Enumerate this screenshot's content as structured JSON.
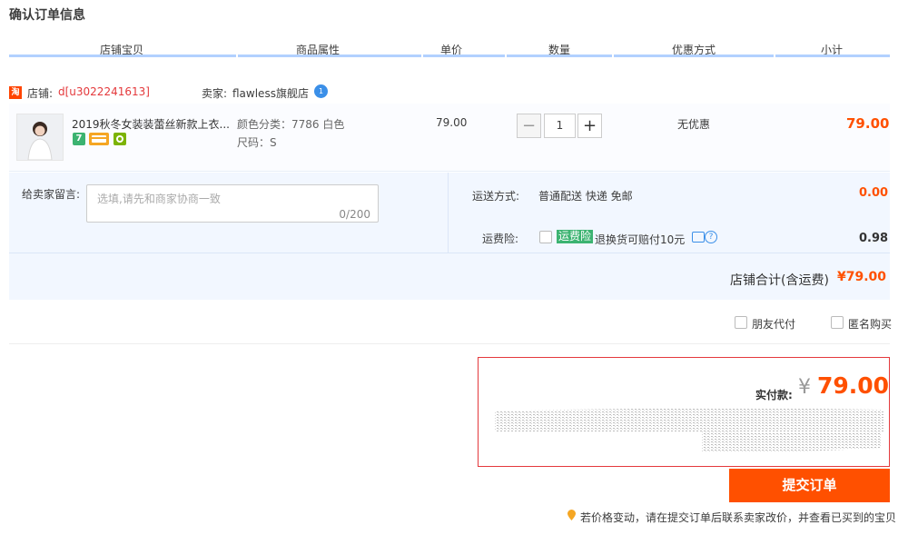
{
  "page": {
    "title": "确认订单信息"
  },
  "columns": [
    "店铺宝贝",
    "商品属性",
    "单价",
    "数量",
    "优惠方式",
    "小计"
  ],
  "shop": {
    "label": "店铺:",
    "name": "d[u3022241613]",
    "seller_label": "卖家:",
    "seller": "flawless旗舰店"
  },
  "item": {
    "title": "2019秋冬女装装蕾丝新款上衣...",
    "attr_color": "颜色分类：7786 白色",
    "attr_size": "尺码：S",
    "unit_price": "79.00",
    "quantity": "1",
    "discount": "无优惠",
    "subtotal": "79.00",
    "badges": [
      {
        "text": "7",
        "color": "#3cb371"
      },
      {
        "icon": "card-icon",
        "color": "#f5a623"
      },
      {
        "icon": "leaf-icon",
        "color": "#7cb305"
      }
    ]
  },
  "message": {
    "label": "给卖家留言:",
    "placeholder": "选填,请先和商家协商一致",
    "counter": "0/200"
  },
  "shipping": {
    "label": "运送方式:",
    "value": "普通配送 快递 免邮",
    "price": "0.00"
  },
  "insurance": {
    "label": "运费险:",
    "tag": "运费险",
    "desc": "退换货可赔付10元",
    "price": "0.98"
  },
  "shop_total": {
    "label": "店铺合计(含运费)",
    "value": "¥79.00"
  },
  "options": {
    "friend_pay": "朋友代付",
    "anonymous": "匿名购买"
  },
  "payment": {
    "label": "实付款:",
    "currency": "¥",
    "amount": "79.00"
  },
  "submit": {
    "label": "提交订单"
  },
  "notice": "若价格变动，请在提交订单后联系卖家改价，并查看已买到的宝贝",
  "colors": {
    "accent": "#ff5000",
    "header_bar": "#b2d1ff",
    "panel": "#f2f7ff"
  }
}
